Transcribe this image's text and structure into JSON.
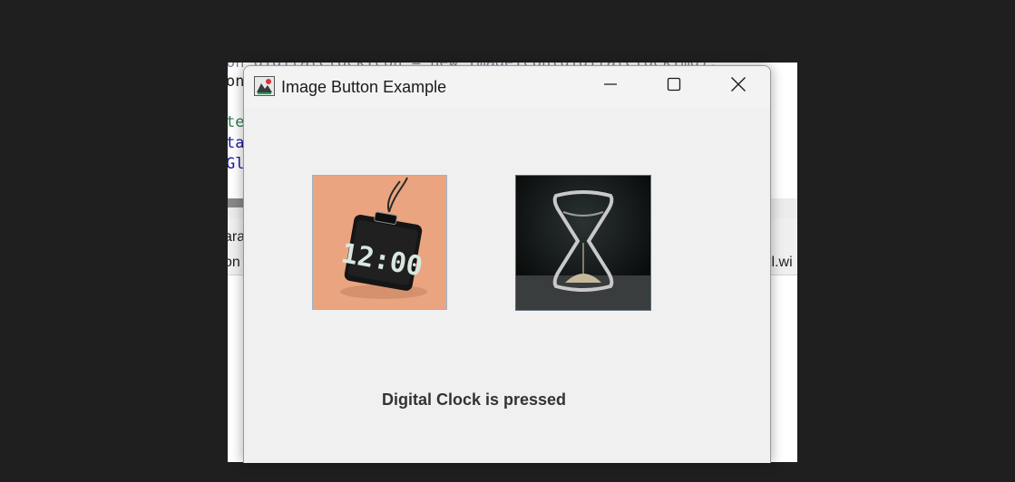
{
  "background_code": {
    "lines": [
      "on digitalClockIcon = new ImageIcon(digitalClockImg);",
      "on",
      "te",
      "ta",
      "Gl"
    ],
    "panel_texts": [
      "ara",
      "on",
      "ll.wi"
    ]
  },
  "window": {
    "title": "Image Button Example",
    "controls": {
      "minimize": "minimize-icon",
      "maximize": "maximize-icon",
      "close": "close-icon"
    }
  },
  "buttons": [
    {
      "name": "Digital Clock",
      "clock_reading": "12:00",
      "background": "#eaa580",
      "body": "#1a1a1a"
    },
    {
      "name": "Hourglass",
      "background": "#0a0c0d",
      "sand": "#c8b89a"
    }
  ],
  "status_text": "Digital Clock is pressed",
  "colors": {
    "window_bg": "#f0f0f0",
    "page_bg": "#1f1f1f",
    "status_text": "#333333"
  }
}
